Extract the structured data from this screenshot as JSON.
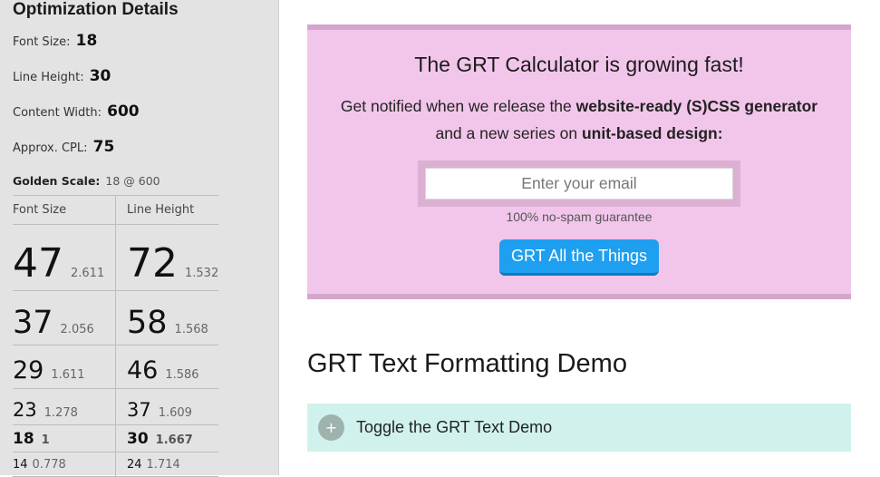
{
  "sidebar": {
    "title": "Optimization Details",
    "font_size": {
      "label": "Font Size:",
      "value": "18"
    },
    "line_height": {
      "label": "Line Height:",
      "value": "30"
    },
    "content_width": {
      "label": "Content Width:",
      "value": "600"
    },
    "cpl": {
      "label": "Approx. CPL:",
      "value": "75"
    },
    "golden": {
      "label": "Golden Scale:",
      "value": "18 @ 600"
    },
    "table": {
      "headers": [
        "Font Size",
        "Line Height"
      ],
      "rows": [
        {
          "fs": "47",
          "fs_ratio": "2.611",
          "lh": "72",
          "lh_ratio": "1.532"
        },
        {
          "fs": "37",
          "fs_ratio": "2.056",
          "lh": "58",
          "lh_ratio": "1.568"
        },
        {
          "fs": "29",
          "fs_ratio": "1.611",
          "lh": "46",
          "lh_ratio": "1.586"
        },
        {
          "fs": "23",
          "fs_ratio": "1.278",
          "lh": "37",
          "lh_ratio": "1.609"
        },
        {
          "fs": "18",
          "fs_ratio": "1",
          "lh": "30",
          "lh_ratio": "1.667"
        },
        {
          "fs": "14",
          "fs_ratio": "0.778",
          "lh": "24",
          "lh_ratio": "1.714"
        }
      ]
    }
  },
  "notify": {
    "title": "The GRT Calculator is growing fast!",
    "line1_pre": "Get notified when we release the ",
    "line1_bold": "website-ready (S)CSS generator",
    "line2_pre": "and a new series on ",
    "line2_bold": "unit-based design:",
    "email_placeholder": "Enter your email",
    "guarantee": "100% no-spam guarantee",
    "button": "GRT All the Things",
    "bg_color": "#f2c6ea",
    "button_color": "#1e9fef"
  },
  "demo": {
    "heading": "GRT Text Formatting Demo",
    "toggle_icon": "+",
    "toggle_label": "Toggle the GRT Text Demo",
    "toggle_bg": "#d1f2ec"
  }
}
